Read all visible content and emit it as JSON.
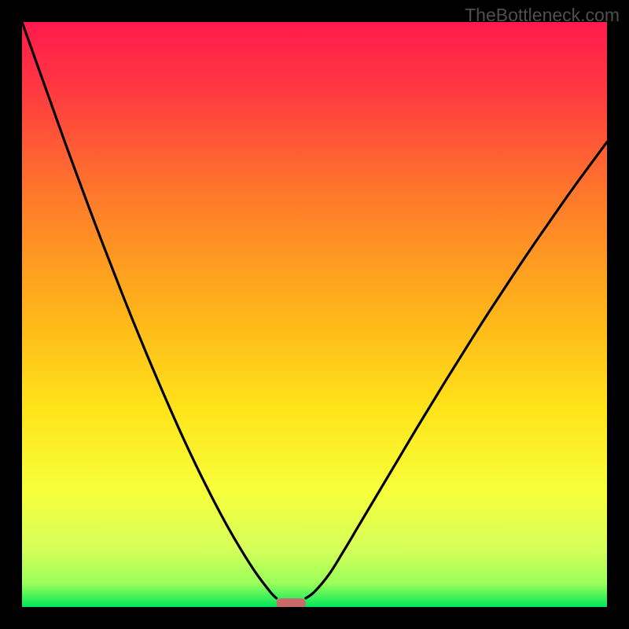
{
  "watermark": "TheBottleneck.com",
  "chart_data": {
    "type": "line",
    "title": "",
    "xlabel": "",
    "ylabel": "",
    "xlim": [
      0,
      100
    ],
    "ylim": [
      0,
      100
    ],
    "grid": false,
    "legend": false,
    "background_gradient": {
      "top_color": "#ff1a4d",
      "mid_colors": [
        "#ff6a33",
        "#ffd21a",
        "#f5ff40",
        "#d2ff66"
      ],
      "bottom_color": "#00e65a",
      "note": "vertical rainbow gradient red→orange→yellow→green"
    },
    "series": [
      {
        "name": "left-arm",
        "x": [
          0.0,
          2.5,
          5.0,
          7.5,
          10.0,
          12.5,
          15.0,
          17.5,
          20.0,
          22.5,
          25.0,
          27.5,
          30.0,
          32.5,
          35.0,
          37.5,
          40.0,
          42.5,
          43.5
        ],
        "y": [
          100.0,
          93.0,
          86.0,
          79.0,
          72.2,
          65.5,
          59.0,
          52.6,
          46.4,
          40.4,
          34.6,
          29.0,
          23.7,
          18.7,
          14.0,
          9.7,
          5.8,
          2.5,
          1.5
        ]
      },
      {
        "name": "right-arm",
        "x": [
          48.5,
          50.0,
          52.5,
          55.0,
          57.5,
          60.0,
          62.5,
          65.0,
          67.5,
          70.0,
          72.5,
          75.0,
          77.5,
          80.0,
          82.5,
          85.0,
          87.5,
          90.0,
          92.5,
          95.0,
          97.5,
          100.0
        ],
        "y": [
          1.5,
          2.6,
          5.6,
          9.6,
          13.8,
          18.0,
          22.2,
          26.4,
          30.6,
          34.7,
          38.8,
          42.8,
          46.8,
          50.7,
          54.5,
          58.3,
          62.0,
          65.6,
          69.2,
          72.7,
          76.1,
          79.5
        ]
      }
    ],
    "marker": {
      "name": "min-marker",
      "x_center": 46.0,
      "width": 5.0,
      "y": 0.6,
      "color": "#c86a6a",
      "shape": "rounded-bar"
    }
  }
}
